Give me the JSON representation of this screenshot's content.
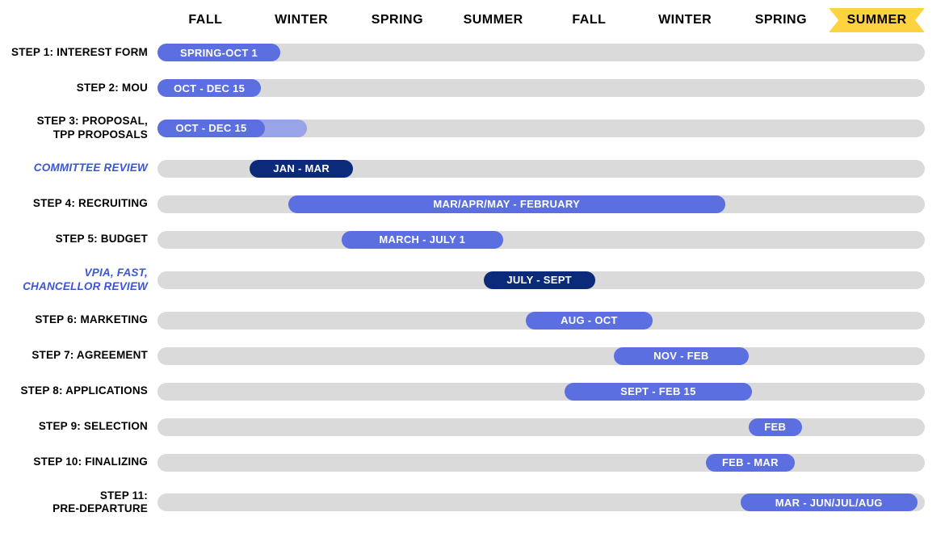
{
  "seasons": [
    "FALL",
    "WINTER",
    "SPRING",
    "SUMMER",
    "FALL",
    "WINTER",
    "SPRING",
    "SUMMER"
  ],
  "highlight_season_index": 7,
  "rows": [
    {
      "label": "STEP 1: INTEREST FORM",
      "style": "normal",
      "bars": [
        {
          "text": "SPRING-OCT 1",
          "start": 0,
          "end": 16,
          "color": "light"
        }
      ]
    },
    {
      "label": "STEP 2: MOU",
      "style": "normal",
      "bars": [
        {
          "text": "OCT - DEC 15",
          "start": 0,
          "end": 13.5,
          "color": "light"
        }
      ]
    },
    {
      "label": "STEP 3: PROPOSAL,\nTPP PROPOSALS",
      "style": "normal",
      "bars": [
        {
          "text": "",
          "start": 0,
          "end": 19.5,
          "color": "faded"
        },
        {
          "text": "OCT - DEC 15",
          "start": 0,
          "end": 14,
          "color": "light",
          "front": true
        }
      ]
    },
    {
      "label": "COMMITTEE REVIEW",
      "style": "italic",
      "bars": [
        {
          "text": "JAN - MAR",
          "start": 12,
          "end": 25.5,
          "color": "dark"
        }
      ]
    },
    {
      "label": "STEP 4: RECRUITING",
      "style": "normal",
      "bars": [
        {
          "text": "MAR/APR/MAY - FEBRUARY",
          "start": 17,
          "end": 74,
          "color": "light"
        }
      ]
    },
    {
      "label": "STEP 5: BUDGET",
      "style": "normal",
      "bars": [
        {
          "text": "MARCH - JULY 1",
          "start": 24,
          "end": 45,
          "color": "light"
        }
      ]
    },
    {
      "label": "VPIA, FAST,\nCHANCELLOR REVIEW",
      "style": "italic",
      "bars": [
        {
          "text": "JULY - SEPT",
          "start": 42.5,
          "end": 57,
          "color": "dark"
        }
      ]
    },
    {
      "label": "STEP 6: MARKETING",
      "style": "normal",
      "bars": [
        {
          "text": "AUG - OCT",
          "start": 48,
          "end": 64.5,
          "color": "light"
        }
      ]
    },
    {
      "label": "STEP 7: AGREEMENT",
      "style": "normal",
      "bars": [
        {
          "text": "NOV - FEB",
          "start": 59.5,
          "end": 77,
          "color": "light"
        }
      ]
    },
    {
      "label": "STEP 8: APPLICATIONS",
      "style": "normal",
      "bars": [
        {
          "text": "SEPT - FEB 15",
          "start": 53,
          "end": 77.5,
          "color": "light"
        }
      ]
    },
    {
      "label": "STEP 9: SELECTION",
      "style": "normal",
      "bars": [
        {
          "text": "FEB",
          "start": 77,
          "end": 84,
          "color": "light"
        }
      ]
    },
    {
      "label": "STEP 10: FINALIZING",
      "style": "normal",
      "bars": [
        {
          "text": "FEB - MAR",
          "start": 71.5,
          "end": 83,
          "color": "light"
        }
      ]
    },
    {
      "label": "STEP 11:\nPRE-DEPARTURE",
      "style": "normal",
      "bars": [
        {
          "text": "MAR - JUN/JUL/AUG",
          "start": 76,
          "end": 99,
          "color": "light"
        }
      ]
    }
  ],
  "chart_data": {
    "type": "bar",
    "title": "",
    "categories": [
      "FALL",
      "WINTER",
      "SPRING",
      "SUMMER",
      "FALL",
      "WINTER",
      "SPRING",
      "SUMMER"
    ],
    "xlabel": "",
    "ylabel": "",
    "ylim": [
      0,
      100
    ],
    "series": [
      {
        "name": "STEP 1: INTEREST FORM",
        "period": "SPRING-OCT 1",
        "start_pct": 0,
        "end_pct": 16
      },
      {
        "name": "STEP 2: MOU",
        "period": "OCT - DEC 15",
        "start_pct": 0,
        "end_pct": 13.5
      },
      {
        "name": "STEP 3: PROPOSAL, TPP PROPOSALS",
        "period": "OCT - DEC 15",
        "start_pct": 0,
        "end_pct": 14,
        "extension_end_pct": 19.5
      },
      {
        "name": "COMMITTEE REVIEW",
        "period": "JAN - MAR",
        "start_pct": 12,
        "end_pct": 25.5,
        "review": true
      },
      {
        "name": "STEP 4: RECRUITING",
        "period": "MAR/APR/MAY - FEBRUARY",
        "start_pct": 17,
        "end_pct": 74
      },
      {
        "name": "STEP 5: BUDGET",
        "period": "MARCH - JULY 1",
        "start_pct": 24,
        "end_pct": 45
      },
      {
        "name": "VPIA, FAST, CHANCELLOR REVIEW",
        "period": "JULY - SEPT",
        "start_pct": 42.5,
        "end_pct": 57,
        "review": true
      },
      {
        "name": "STEP 6: MARKETING",
        "period": "AUG - OCT",
        "start_pct": 48,
        "end_pct": 64.5
      },
      {
        "name": "STEP 7: AGREEMENT",
        "period": "NOV - FEB",
        "start_pct": 59.5,
        "end_pct": 77
      },
      {
        "name": "STEP 8: APPLICATIONS",
        "period": "SEPT - FEB 15",
        "start_pct": 53,
        "end_pct": 77.5
      },
      {
        "name": "STEP 9: SELECTION",
        "period": "FEB",
        "start_pct": 77,
        "end_pct": 84
      },
      {
        "name": "STEP 10: FINALIZING",
        "period": "FEB - MAR",
        "start_pct": 71.5,
        "end_pct": 83
      },
      {
        "name": "STEP 11: PRE-DEPARTURE",
        "period": "MAR - JUN/JUL/AUG",
        "start_pct": 76,
        "end_pct": 99
      }
    ]
  }
}
